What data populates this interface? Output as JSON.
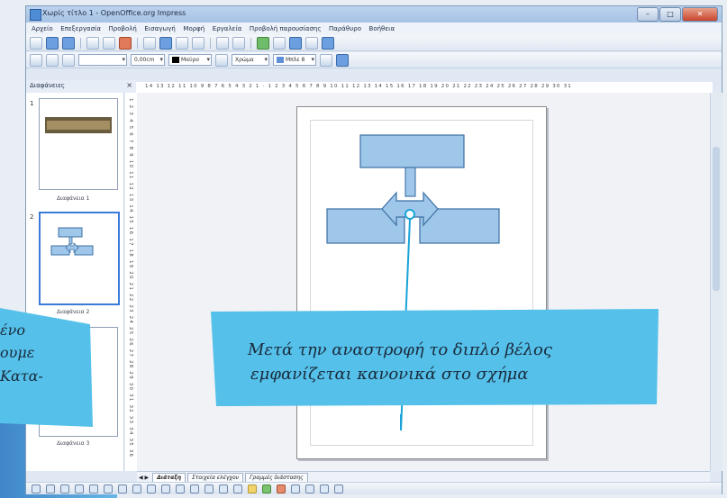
{
  "window": {
    "title": "Χωρίς τίτλο 1 - OpenOffice.org Impress",
    "buttons": {
      "minimize": "–",
      "maximize": "□",
      "close": "✕"
    }
  },
  "menu": [
    "Αρχείο",
    "Επεξεργασία",
    "Προβολή",
    "Εισαγωγή",
    "Μορφή",
    "Εργαλεία",
    "Προβολή παρουσίασης",
    "Παράθυρο",
    "Βοήθεια"
  ],
  "toolbar2": {
    "line_width": "0,00cm",
    "line_color": "Μαύρο",
    "area_style": "Χρώμα",
    "area_color": "Μπλε 8"
  },
  "slides_panel": {
    "title": "Διαφάνειες",
    "close": "×",
    "slides": [
      {
        "number": "1",
        "label": "Διαφάνεια 1"
      },
      {
        "number": "2",
        "label": "Διαφάνεια 2"
      },
      {
        "number": "3",
        "label": "Διαφάνεια 3"
      }
    ]
  },
  "ruler": {
    "horizontal": "14 13 12 11 10 9 8 7 6 5 4 3 2 1 · 1 2 3 4 5 6 7 8 9 10 11 12 13 14 15 16 17 18 19 20 21 22 23 24 25 26 27 28 29 30 31",
    "vertical": "1 2 3 4 5 6 7 8 9 10 11 12 13 14 15 16 17 18 19 20 21 22 23 24 25 26 27 28 29 30 31 32 33 34 35 36"
  },
  "view_tabs": {
    "nav": "◀ ▶",
    "tabs": [
      "Διάταξη",
      "Στοιχεία ελέγχου",
      "Γραμμές διάστασης"
    ]
  },
  "callout_main": {
    "line1": "Μετά την αναστροφή το διπλό βέλος",
    "line2": "εμφανίζεται κανονικά στο σχήμα"
  },
  "callout_left": {
    "line1": "ένο",
    "line2": "ουμε",
    "line3": "Κατα-"
  },
  "colors": {
    "callout_fill": "#55c1ea",
    "shape_fill": "#9fc7ea",
    "shape_stroke": "#3c6fa4",
    "pointer_line": "#1aa3d8"
  }
}
